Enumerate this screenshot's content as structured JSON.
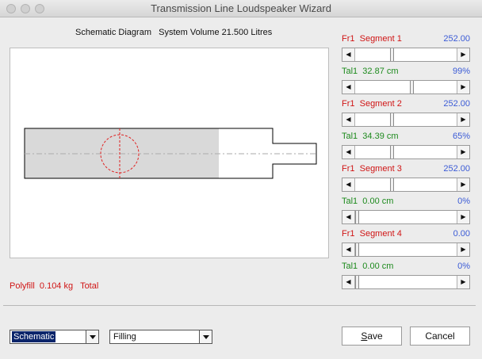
{
  "window": {
    "title": "Transmission Line Loudspeaker Wizard"
  },
  "diagram": {
    "caption": "Schematic Diagram   System Volume 21.500 Litres"
  },
  "segments": [
    {
      "fr_label": "Fr1  Segment 1",
      "fr_value": "252.00",
      "fr_level": 0.35,
      "tal_label": "Tal1  32.87 cm",
      "tal_value": "99%",
      "tal_level": 0.55
    },
    {
      "fr_label": "Fr1  Segment 2",
      "fr_value": "252.00",
      "fr_level": 0.35,
      "tal_label": "Tal1  34.39 cm",
      "tal_value": "65%",
      "tal_level": 0.35
    },
    {
      "fr_label": "Fr1  Segment 3",
      "fr_value": "252.00",
      "fr_level": 0.35,
      "tal_label": "Tal1  0.00 cm",
      "tal_value": "0%",
      "tal_level": 0.0
    },
    {
      "fr_label": "Fr1  Segment 4",
      "fr_value": "0.00",
      "fr_level": 0.0,
      "tal_label": "Tal1  0.00 cm",
      "tal_value": "0%",
      "tal_level": 0.0
    }
  ],
  "status": {
    "polyfill": "Polyfill  0.104 kg   Total"
  },
  "controls": {
    "view_select": "Schematic",
    "mode_select": "Filling",
    "save_label": "Save",
    "save_mnemonic": "S",
    "save_rest": "ave",
    "cancel_label": "Cancel"
  },
  "colors": {
    "fr_label": "#d01515",
    "tal_label": "#1d8a1d",
    "value": "#3b5bd6",
    "fill": "#d9d9d9",
    "driver": "#e02020"
  }
}
